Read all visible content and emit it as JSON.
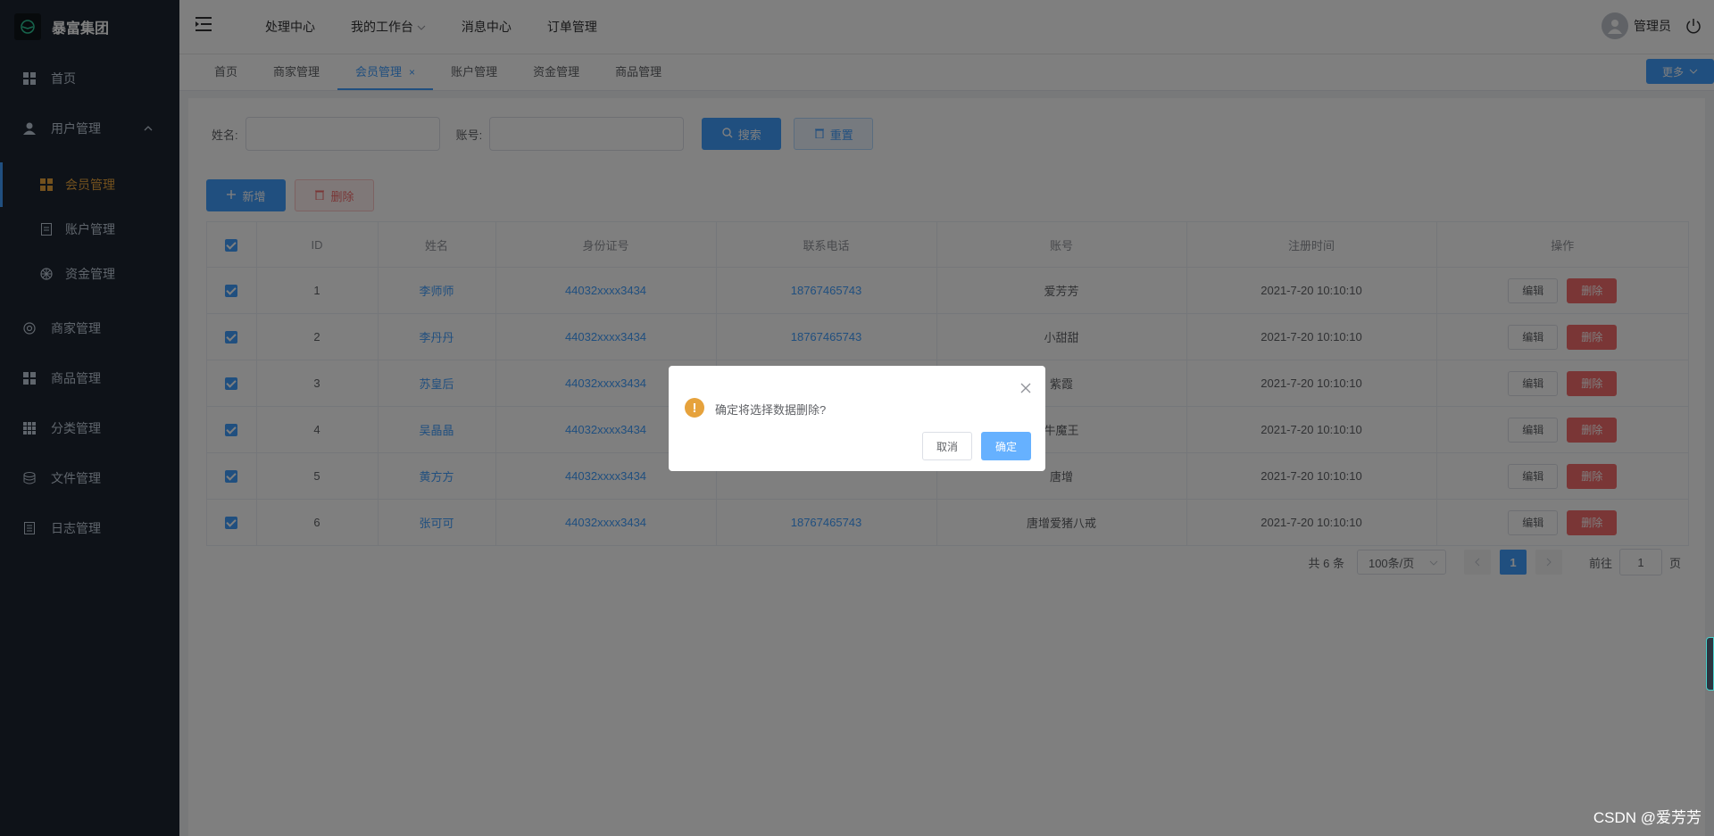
{
  "app": {
    "brand_title": "暴富集团"
  },
  "sidebar": {
    "items": [
      {
        "label": "首页"
      },
      {
        "label": "用户管理"
      },
      {
        "label": "商家管理"
      },
      {
        "label": "商品管理"
      },
      {
        "label": "分类管理"
      },
      {
        "label": "文件管理"
      },
      {
        "label": "日志管理"
      }
    ],
    "sub_items": [
      {
        "label": "会员管理"
      },
      {
        "label": "账户管理"
      },
      {
        "label": "资金管理"
      }
    ]
  },
  "header": {
    "nav": [
      "处理中心",
      "我的工作台",
      "消息中心",
      "订单管理"
    ],
    "user_name": "管理员"
  },
  "tabs": {
    "items": [
      "首页",
      "商家管理",
      "会员管理",
      "账户管理",
      "资金管理",
      "商品管理"
    ],
    "close_label": "×",
    "more_label": "更多"
  },
  "filter": {
    "name_label": "姓名:",
    "name_value": "",
    "account_label": "账号:",
    "account_value": "",
    "search_label": "搜索",
    "reset_label": "重置"
  },
  "actions": {
    "add_label": "新增",
    "delete_label": "删除"
  },
  "table": {
    "columns": [
      "ID",
      "姓名",
      "身份证号",
      "联系电话",
      "账号",
      "注册时间",
      "操作"
    ],
    "edit_label": "编辑",
    "delete_label": "删除",
    "rows": [
      {
        "id": "1",
        "name": "李师师",
        "idcard": "44032xxxx3434",
        "phone": "18767465743",
        "account": "爱芳芳",
        "time": "2021-7-20 10:10:10"
      },
      {
        "id": "2",
        "name": "李丹丹",
        "idcard": "44032xxxx3434",
        "phone": "18767465743",
        "account": "小甜甜",
        "time": "2021-7-20 10:10:10"
      },
      {
        "id": "3",
        "name": "苏皇后",
        "idcard": "44032xxxx3434",
        "phone": "",
        "account": "紫霞",
        "time": "2021-7-20 10:10:10"
      },
      {
        "id": "4",
        "name": "吴晶晶",
        "idcard": "44032xxxx3434",
        "phone": "",
        "account": "牛魔王",
        "time": "2021-7-20 10:10:10"
      },
      {
        "id": "5",
        "name": "黄方方",
        "idcard": "44032xxxx3434",
        "phone": "",
        "account": "唐增",
        "time": "2021-7-20 10:10:10"
      },
      {
        "id": "6",
        "name": "张可可",
        "idcard": "44032xxxx3434",
        "phone": "18767465743",
        "account": "唐增爱猪八戒",
        "time": "2021-7-20 10:10:10"
      }
    ]
  },
  "pagination": {
    "total": "共 6 条",
    "page_size": "100条/页",
    "current_page": "1",
    "goto_prefix": "前往",
    "goto_value": "1",
    "goto_suffix": "页"
  },
  "dialog": {
    "message": "确定将选择数据删除?",
    "cancel_label": "取消",
    "confirm_label": "确定"
  },
  "watermark": "CSDN @爱芳芳",
  "colors": {
    "primary": "#409eff",
    "danger": "#f56c6c",
    "warning": "#e6a23c",
    "sidebar_bg": "#1d2430",
    "active_menu": "#e6a23c"
  }
}
